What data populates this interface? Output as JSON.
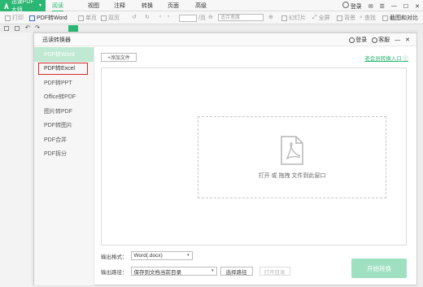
{
  "menubar": {
    "app_name": "迅读PDF大师",
    "items": [
      "阅读",
      "视图",
      "注释",
      "转换",
      "页面",
      "高级"
    ],
    "login": "登录"
  },
  "toolbar": {
    "print": "打印",
    "pdf_to_word": "PDF转Word",
    "single_page": "单页",
    "double_page": "双页",
    "page_total": "/页",
    "zoom": "适合宽度",
    "slideshow": "幻灯片",
    "fullscreen": "全屏",
    "background": "背景",
    "find": "查找",
    "screenshot": "截图和对比"
  },
  "dialog": {
    "title": "迅读转换器",
    "login": "登录",
    "service": "客服",
    "sidebar": [
      "PDF转Word",
      "PDF转Excel",
      "PDF转PPT",
      "Office转PDF",
      "图片转PDF",
      "PDF转图片",
      "PDF合并",
      "PDF拆分"
    ],
    "add_file": "+添加文件",
    "member_link": "老会员转换入口",
    "drop_text": "打开 或 拖拽 文件到此窗口",
    "output_format_label": "输出格式：",
    "output_format_value": "Word(.docx)",
    "output_path_label": "输出路径：",
    "output_path_value": "保存到文档当前目录",
    "choose_path": "选择路径",
    "open_dir": "打开目录",
    "start": "开始转换"
  },
  "colors": {
    "accent": "#2bb673",
    "sidebar_active": "#bfe9d2",
    "start_button": "#9fe0c1",
    "highlight": "#d42a2a"
  }
}
